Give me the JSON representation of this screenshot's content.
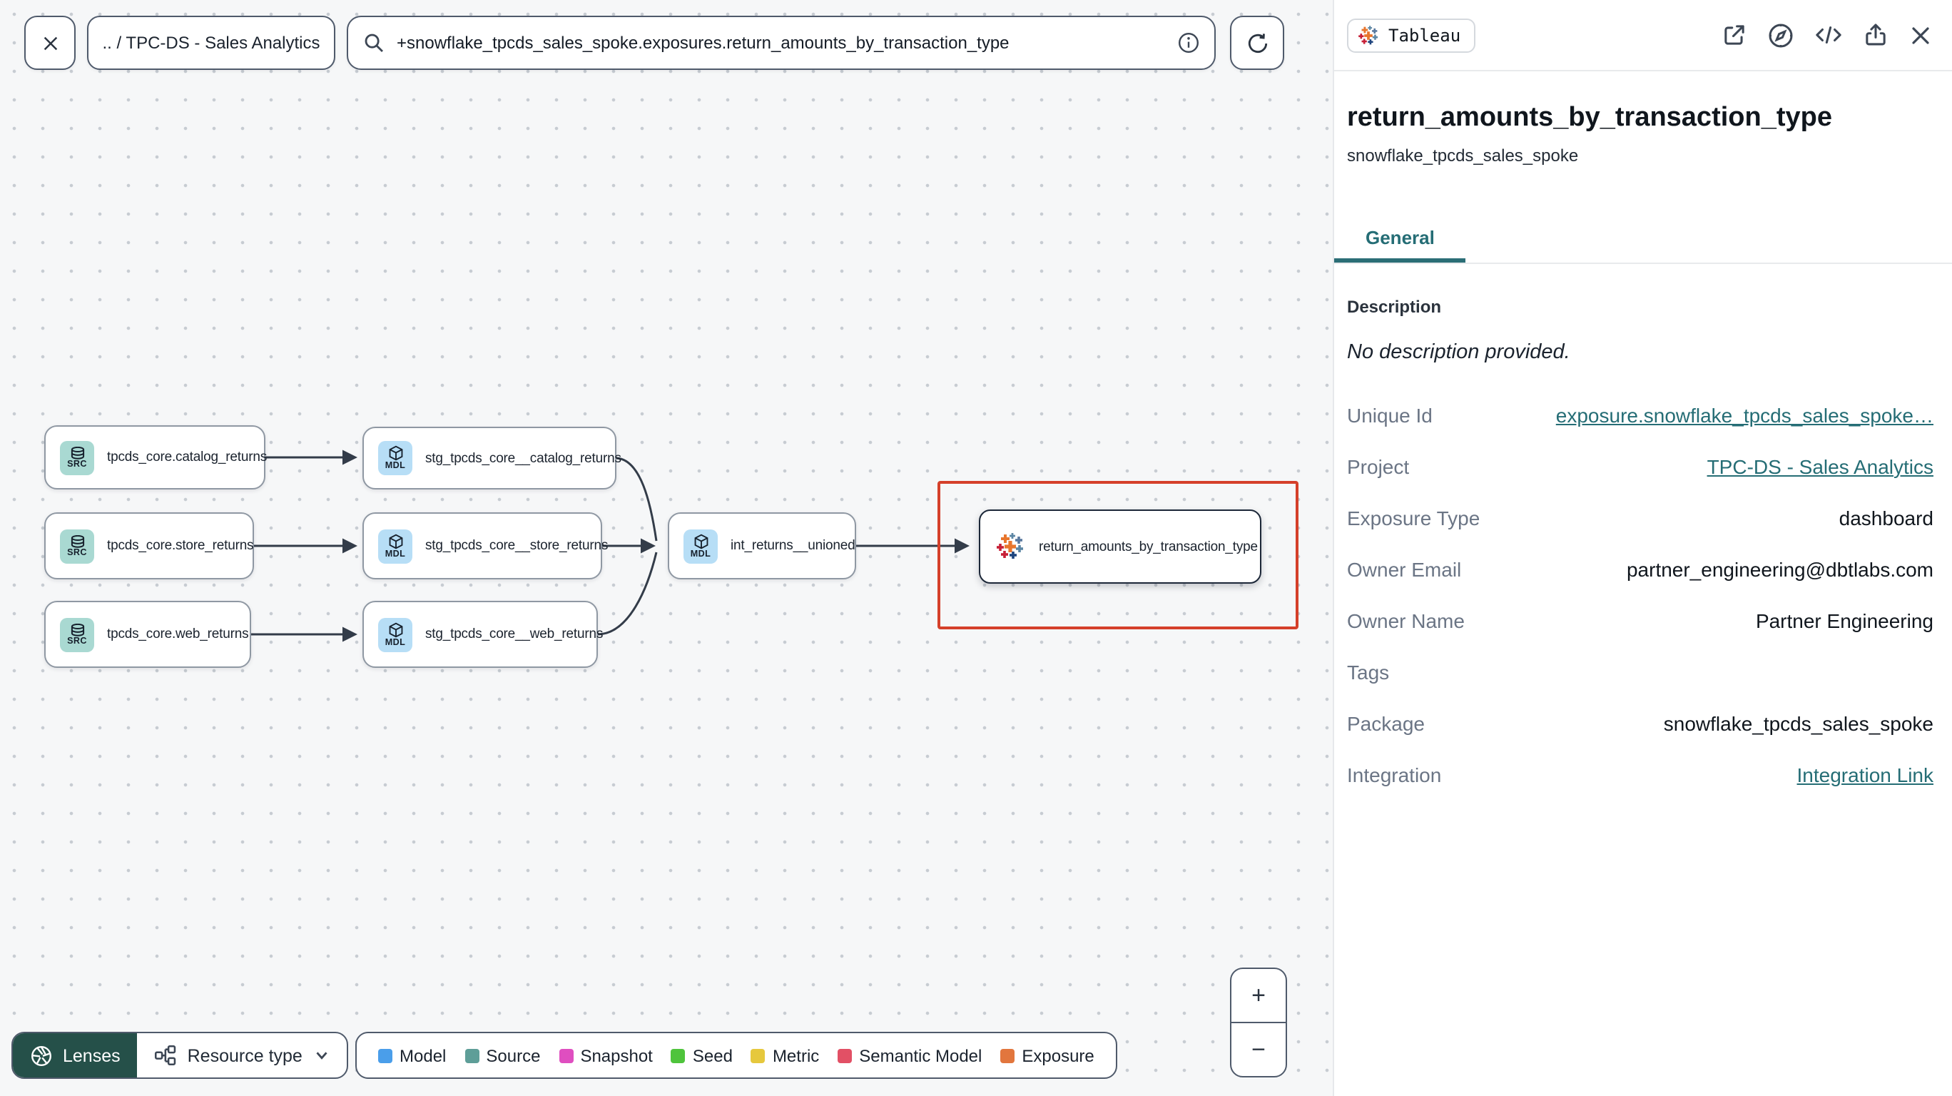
{
  "topbar": {
    "breadcrumb": ".. / TPC-DS - Sales Analytics",
    "search_value": "+snowflake_tpcds_sales_spoke.exposures.return_amounts_by_transaction_type"
  },
  "graph": {
    "nodes": [
      {
        "badge": "SRC",
        "label": "tpcds_core.catalog_returns"
      },
      {
        "badge": "SRC",
        "label": "tpcds_core.store_returns"
      },
      {
        "badge": "SRC",
        "label": "tpcds_core.web_returns"
      },
      {
        "badge": "MDL",
        "label": "stg_tpcds_core__catalog_returns"
      },
      {
        "badge": "MDL",
        "label": "stg_tpcds_core__store_returns"
      },
      {
        "badge": "MDL",
        "label": "stg_tpcds_core__web_returns"
      },
      {
        "badge": "MDL",
        "label": "int_returns__unioned"
      },
      {
        "badge": "tableau-icon",
        "label": "return_amounts_by_transaction_type"
      }
    ]
  },
  "controls": {
    "lenses_label": "Lenses",
    "resource_type_label": "Resource type",
    "zoom_in_label": "+",
    "zoom_out_label": "−"
  },
  "legend": {
    "items": [
      {
        "label": "Model",
        "color": "#4a9eea"
      },
      {
        "label": "Source",
        "color": "#5e9e98"
      },
      {
        "label": "Snapshot",
        "color": "#df4ec0"
      },
      {
        "label": "Seed",
        "color": "#4fc43c"
      },
      {
        "label": "Metric",
        "color": "#e6c83d"
      },
      {
        "label": "Semantic Model",
        "color": "#e25065"
      },
      {
        "label": "Exposure",
        "color": "#e2763d"
      }
    ]
  },
  "panel": {
    "integration_badge": "Tableau",
    "title": "return_amounts_by_transaction_type",
    "subtitle": "snowflake_tpcds_sales_spoke",
    "tabs": [
      {
        "label": "General"
      }
    ],
    "description_heading": "Description",
    "description_empty": "No description provided.",
    "fields": [
      {
        "label": "Unique Id",
        "value": "exposure.snowflake_tpcds_sales_spoke…"
      },
      {
        "label": "Project",
        "value": "TPC-DS - Sales Analytics"
      },
      {
        "label": "Exposure Type",
        "value": "dashboard"
      },
      {
        "label": "Owner Email",
        "value": "partner_engineering@dbtlabs.com"
      },
      {
        "label": "Owner Name",
        "value": "Partner Engineering"
      },
      {
        "label": "Tags",
        "value": ""
      },
      {
        "label": "Package",
        "value": "snowflake_tpcds_sales_spoke"
      },
      {
        "label": "Integration",
        "value": "Integration Link"
      }
    ]
  },
  "colors": {
    "accent_teal": "#256d75",
    "highlight_red": "#d5402a",
    "lenses_green": "#255049",
    "model_blue": "#4a9eea",
    "source_teal": "#a9d9d2",
    "mdl_blue": "#b7def6"
  }
}
